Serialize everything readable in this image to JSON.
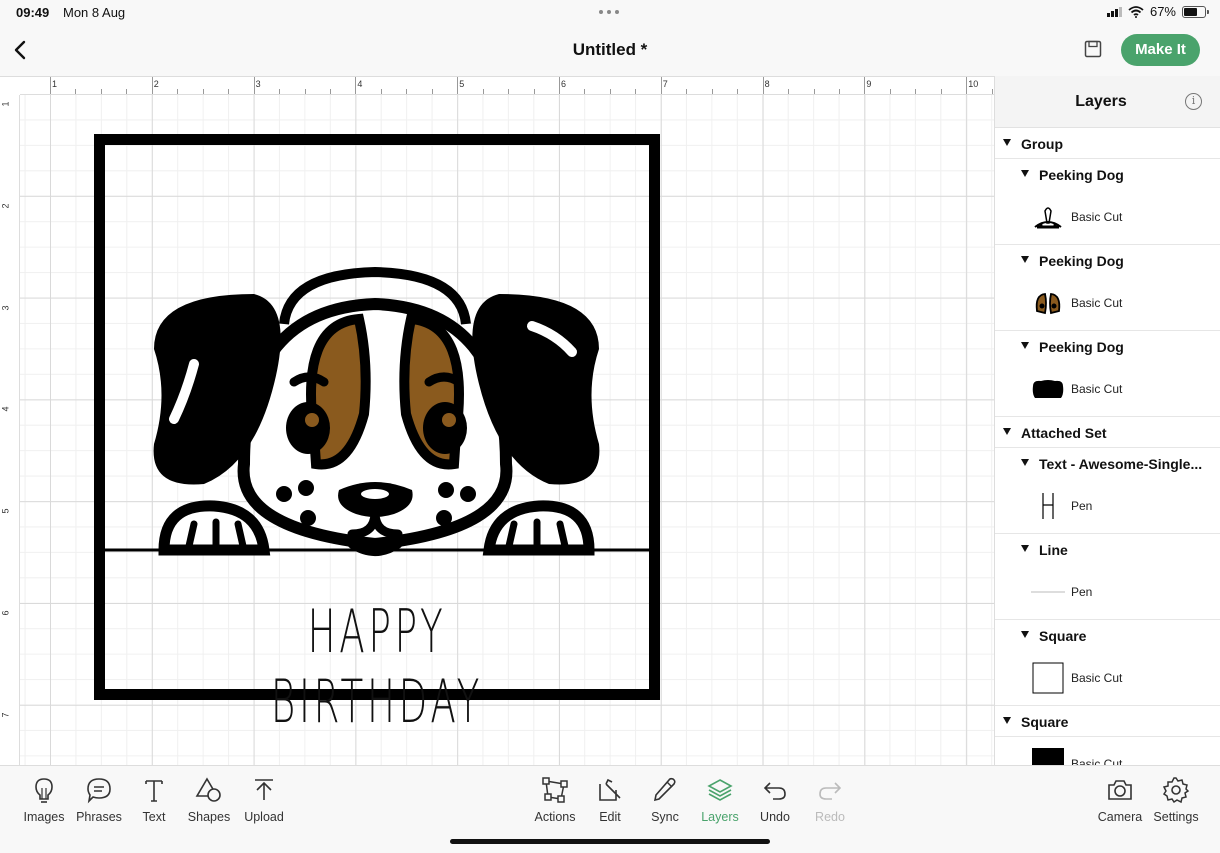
{
  "status_bar": {
    "time": "09:49",
    "date": "Mon 8 Aug",
    "battery": "67%",
    "battery_level": 0.67
  },
  "header": {
    "title": "Untitled *",
    "make_it_label": "Make It",
    "back_icon": "chevron-left-icon",
    "save_icon": "save-icon"
  },
  "ruler": {
    "top": [
      "1",
      "2",
      "3",
      "4",
      "5",
      "6",
      "7",
      "8",
      "9",
      "10"
    ],
    "left": [
      "1",
      "2",
      "3",
      "4",
      "5",
      "6",
      "7"
    ]
  },
  "canvas": {
    "greeting_text": "HAPPY BIRTHDAY",
    "colors": {
      "black": "#000000",
      "brown": "#8a5a1e",
      "white": "#ffffff"
    }
  },
  "layers": {
    "title": "Layers",
    "rows": [
      {
        "kind": "group",
        "label": "Group"
      },
      {
        "kind": "sub",
        "label": "Peeking Dog"
      },
      {
        "kind": "item",
        "op": "Basic Cut",
        "thumb": "dog-outline"
      },
      {
        "kind": "sub",
        "label": "Peeking Dog"
      },
      {
        "kind": "item",
        "op": "Basic Cut",
        "thumb": "dog-ears-brown"
      },
      {
        "kind": "sub",
        "label": "Peeking Dog"
      },
      {
        "kind": "item",
        "op": "Basic Cut",
        "thumb": "dog-black-base"
      },
      {
        "kind": "group",
        "label": "Attached Set"
      },
      {
        "kind": "sub",
        "label": "Text - Awesome-Single..."
      },
      {
        "kind": "item",
        "op": "Pen",
        "thumb": "text-glyph"
      },
      {
        "kind": "sub",
        "label": "Line"
      },
      {
        "kind": "item",
        "op": "Pen",
        "thumb": "line"
      },
      {
        "kind": "sub",
        "label": "Square"
      },
      {
        "kind": "item",
        "op": "Basic Cut",
        "thumb": "square-outline"
      },
      {
        "kind": "group",
        "label": "Square"
      },
      {
        "kind": "item",
        "op": "Basic Cut",
        "thumb": "square-filled"
      }
    ]
  },
  "toolbar": {
    "left": [
      {
        "label": "Images",
        "icon": "lightbulb-icon"
      },
      {
        "label": "Phrases",
        "icon": "speech-bubble-icon"
      },
      {
        "label": "Text",
        "icon": "text-icon"
      },
      {
        "label": "Shapes",
        "icon": "shapes-icon"
      },
      {
        "label": "Upload",
        "icon": "upload-icon"
      }
    ],
    "center": [
      {
        "label": "Actions",
        "icon": "actions-icon"
      },
      {
        "label": "Edit",
        "icon": "edit-icon"
      },
      {
        "label": "Sync",
        "icon": "sync-icon"
      },
      {
        "label": "Layers",
        "icon": "layers-icon",
        "active": true
      },
      {
        "label": "Undo",
        "icon": "undo-icon"
      },
      {
        "label": "Redo",
        "icon": "redo-icon",
        "disabled": true
      }
    ],
    "right": [
      {
        "label": "Camera",
        "icon": "camera-icon"
      },
      {
        "label": "Settings",
        "icon": "settings-icon"
      }
    ],
    "accent": "#4aa36c"
  }
}
